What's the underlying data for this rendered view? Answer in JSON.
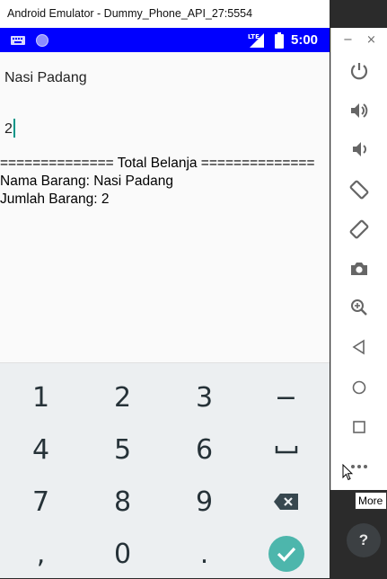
{
  "window": {
    "title": "Android Emulator - Dummy_Phone_API_27:5554"
  },
  "statusbar": {
    "time": "5:00",
    "network": "LTE"
  },
  "app": {
    "name_value": "Nasi Padang",
    "qty_value": "2",
    "summary_header": "============== Total Belanja ==============",
    "summary_name": "Nama Barang: Nasi Padang",
    "summary_qty": "Jumlah Barang: 2"
  },
  "keyboard": {
    "keys": [
      "1",
      "2",
      "3",
      "−",
      "4",
      "5",
      "6",
      "space",
      "7",
      "8",
      "9",
      "backspace",
      ",",
      "0",
      ".",
      "done"
    ],
    "labels": {
      "k1": "1",
      "k2": "2",
      "k3": "3",
      "minus": "−",
      "k4": "4",
      "k5": "5",
      "k6": "6",
      "k7": "7",
      "k8": "8",
      "k9": "9",
      "comma": ",",
      "k0": "0",
      "period": "."
    },
    "done_color": "#4db6ac"
  },
  "side_panel": {
    "minimize": "−",
    "close": "×",
    "buttons": [
      "power-icon",
      "volume-up-icon",
      "volume-down-icon",
      "rotate-left-icon",
      "rotate-right-icon",
      "camera-icon",
      "zoom-icon",
      "back-icon",
      "home-icon",
      "overview-icon",
      "more-icon"
    ]
  },
  "tooltip": "More",
  "help_label": "?",
  "colors": {
    "status_bar": "#0000ff",
    "accent": "#009688"
  }
}
